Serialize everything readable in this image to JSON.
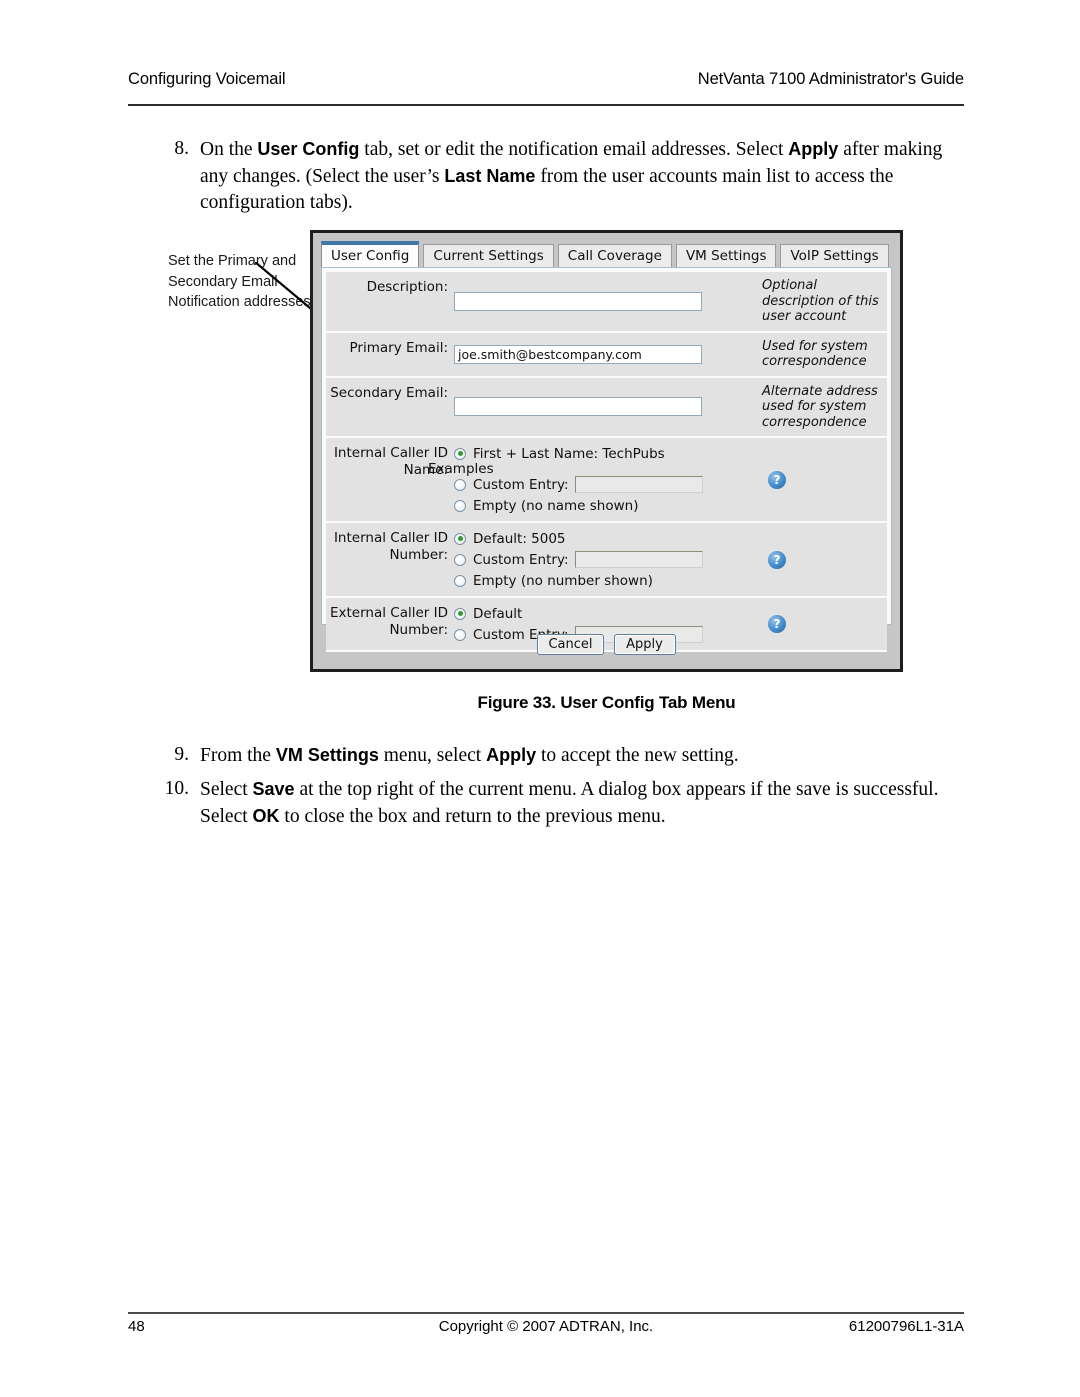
{
  "header": {
    "left": "Configuring Voicemail",
    "right": "NetVanta 7100 Administrator's Guide"
  },
  "steps": [
    {
      "number": "8.",
      "text_parts": [
        {
          "t": "On the ",
          "bold": false
        },
        {
          "t": "User Config",
          "bold": true
        },
        {
          "t": " tab, set or edit the notification email addresses. Select ",
          "bold": false
        },
        {
          "t": "Apply",
          "bold": true
        },
        {
          "t": " after making any changes. (Select the user’s ",
          "bold": false
        },
        {
          "t": "Last Name",
          "bold": true
        },
        {
          "t": " from the user accounts main list to access the configuration tabs).",
          "bold": false
        }
      ]
    },
    {
      "number": "9.",
      "text_parts": [
        {
          "t": "From the ",
          "bold": false
        },
        {
          "t": "VM Settings",
          "bold": true
        },
        {
          "t": " menu, select ",
          "bold": false
        },
        {
          "t": "Apply",
          "bold": true
        },
        {
          "t": " to accept the new setting.",
          "bold": false
        }
      ]
    },
    {
      "number": "10.",
      "text_parts": [
        {
          "t": "Select ",
          "bold": false
        },
        {
          "t": "Save",
          "bold": true
        },
        {
          "t": " at the top right of the current menu. A dialog box appears if the save is successful. Select ",
          "bold": false
        },
        {
          "t": "OK",
          "bold": true
        },
        {
          "t": " to close the box and return to the previous menu.",
          "bold": false
        }
      ]
    }
  ],
  "callout": {
    "text": "Set the Primary and Secondary Email Notification addresses."
  },
  "figure": {
    "caption": "Figure 33.  User Config Tab Menu",
    "tabs": [
      {
        "label": "User Config",
        "active": true
      },
      {
        "label": "Current Settings",
        "active": false
      },
      {
        "label": "Call Coverage",
        "active": false
      },
      {
        "label": "VM Settings",
        "active": false
      },
      {
        "label": "VoIP Settings",
        "active": false
      }
    ],
    "fields": [
      {
        "label": "Description:",
        "value": "",
        "hint": "Optional description of this user account"
      },
      {
        "label": "Primary Email:",
        "value": "joe.smith@bestcompany.com",
        "hint": "Used for system correspondence"
      },
      {
        "label": "Secondary Email:",
        "value": "",
        "hint": "Alternate address used for system correspondence"
      }
    ],
    "radio_groups": [
      {
        "label": "Internal Caller ID Name:",
        "overflow_note": "Examples",
        "help_icon": "help-icon",
        "options": [
          {
            "label": "First + Last Name: TechPubs",
            "checked": true,
            "input": false
          },
          {
            "label": "Custom Entry:",
            "checked": false,
            "input": true
          },
          {
            "label": "Empty (no name shown)",
            "checked": false,
            "input": false
          }
        ]
      },
      {
        "label": "Internal Caller ID Number:",
        "overflow_note": "",
        "help_icon": "help-icon",
        "options": [
          {
            "label": "Default: 5005",
            "checked": true,
            "input": false
          },
          {
            "label": "Custom Entry:",
            "checked": false,
            "input": true
          },
          {
            "label": "Empty (no number shown)",
            "checked": false,
            "input": false
          }
        ]
      },
      {
        "label": "External Caller ID Number:",
        "overflow_note": "",
        "help_icon": "help-icon",
        "options": [
          {
            "label": "Default",
            "checked": true,
            "input": false
          },
          {
            "label": "Custom Entry:",
            "checked": false,
            "input": true
          }
        ]
      }
    ],
    "buttons": [
      {
        "label": "Cancel"
      },
      {
        "label": "Apply"
      }
    ],
    "help_glyph": "?",
    "colors": {
      "active_tab_accent": "#3f76a8",
      "row_background": "#e2e2e2",
      "radio_selected": "#2d9b2d",
      "help_icon": "#3c86c6",
      "frame_border": "#1e1e1e"
    }
  },
  "footer": {
    "page_number": "48",
    "copyright": "Copyright © 2007 ADTRAN, Inc.",
    "doc_number": "61200796L1-31A"
  }
}
